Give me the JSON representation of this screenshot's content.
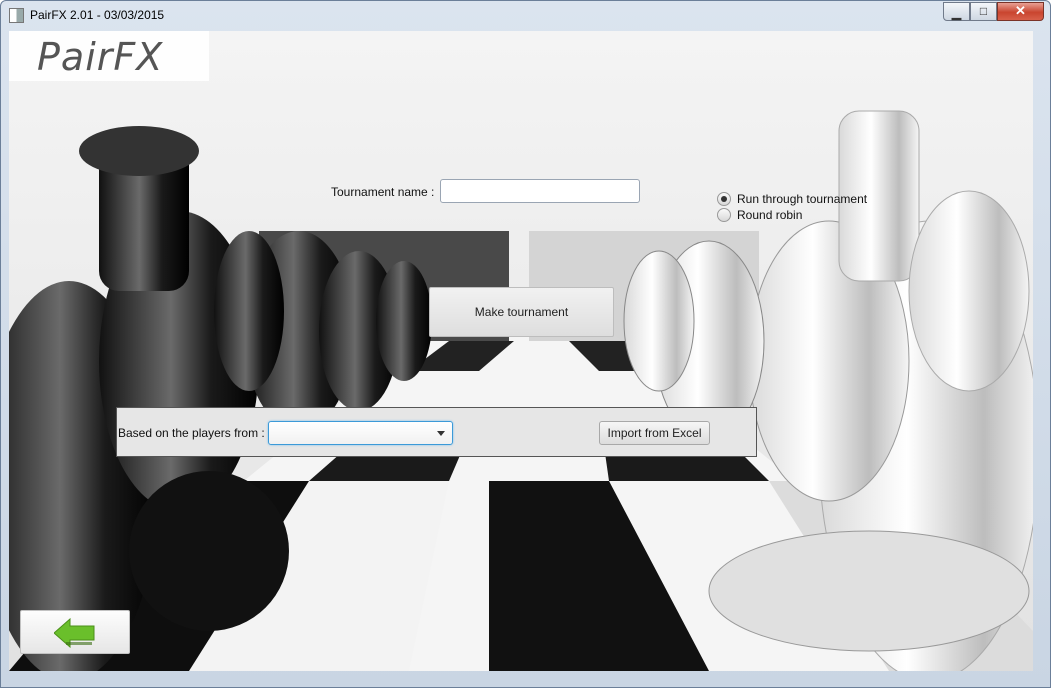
{
  "window": {
    "title": "PairFX 2.01 - 03/03/2015",
    "min_glyph": "▁",
    "max_glyph": "□",
    "close_glyph": "✕"
  },
  "logo": {
    "text": "PairFX"
  },
  "form": {
    "tournament_name_label": "Tournament name :",
    "tournament_name_value": "",
    "mode_options": [
      {
        "label": "Run through tournament",
        "selected": true
      },
      {
        "label": "Round robin",
        "selected": false
      }
    ],
    "make_button": "Make tournament"
  },
  "import": {
    "players_from_label": "Based on the players from :",
    "players_from_value": "",
    "import_button": "Import from Excel"
  },
  "back": {
    "icon": "back-arrow-icon"
  },
  "colors": {
    "accent_green": "#6abf2b",
    "focus_blue": "#3c9ad8"
  }
}
